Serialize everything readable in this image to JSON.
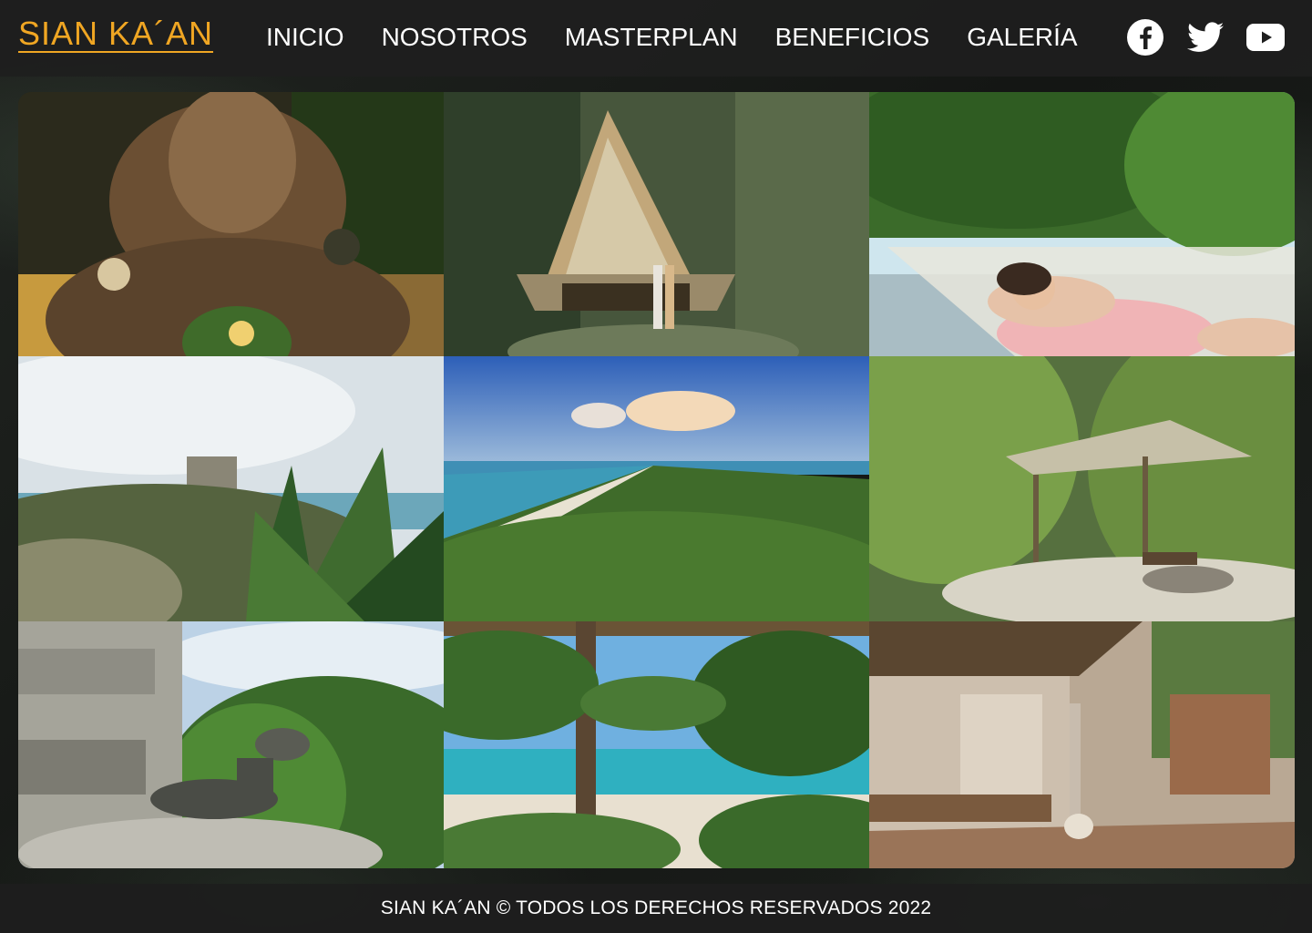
{
  "header": {
    "logo": "SIAN KA´AN",
    "nav": [
      "INICIO",
      "NOSOTROS",
      "MASTERPLAN",
      "BENEFICIOS",
      "GALERÍA"
    ],
    "social": [
      "facebook-icon",
      "twitter-icon",
      "youtube-icon"
    ]
  },
  "gallery": {
    "photos": [
      "wooden-statue-photo",
      "jungle-cabin-photo",
      "hammock-photo",
      "tulum-ruins-photo",
      "coastline-aerial-photo",
      "jungle-pavilion-photo",
      "iguana-photo",
      "palm-beach-photo",
      "thatched-lounge-photo"
    ]
  },
  "footer": {
    "text": "SIAN KA´AN © TODOS LOS DERECHOS RESERVADOS 2022"
  },
  "colors": {
    "accent": "#f0a623",
    "header_bg": "#1e1e1e",
    "text": "#ffffff"
  }
}
